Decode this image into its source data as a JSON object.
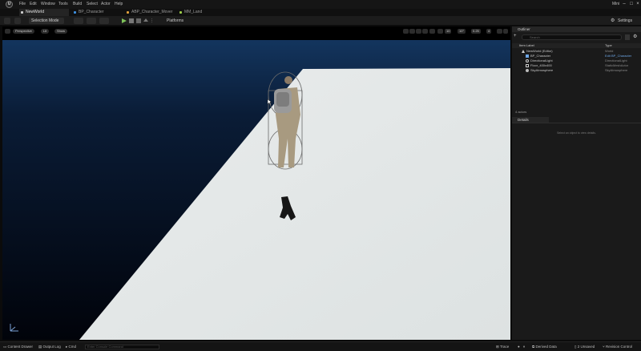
{
  "menu": {
    "items": [
      "File",
      "Edit",
      "Window",
      "Tools",
      "Build",
      "Select",
      "Actor",
      "Help"
    ],
    "window_title": "Mini"
  },
  "tabs": [
    {
      "label": "NewWorld",
      "active": true,
      "color": "#cfcfcf"
    },
    {
      "label": "BP_Character",
      "active": false,
      "color": "#3d8fe0"
    },
    {
      "label": "ABP_Character_Mover",
      "active": false,
      "color": "#e0a13d"
    },
    {
      "label": "MM_Land",
      "active": false,
      "color": "#9fd04a"
    }
  ],
  "toolbar": {
    "selection_mode": "Selection Mode",
    "platforms": "Platforms",
    "settings": "Settings"
  },
  "viewport": {
    "perspective": "Perspective",
    "lit": "Lit",
    "show": "Show",
    "grid_snap": "10",
    "rot_snap": "10°",
    "scale_snap": "0.25",
    "cam_speed": "4"
  },
  "outliner": {
    "tab_label": "Outliner",
    "search_placeholder": "Search",
    "col_label": "Item Label",
    "col_type": "Type",
    "rows": [
      {
        "label": "NewWorld (Editor)",
        "type": "World",
        "indent": 1
      },
      {
        "label": "BP_Character",
        "type": "Edit BP_Character",
        "indent": 2,
        "link": true
      },
      {
        "label": "DirectionalLight",
        "type": "DirectionalLight",
        "indent": 2
      },
      {
        "label": "Floor_400x400",
        "type": "StaticMeshActor",
        "indent": 2
      },
      {
        "label": "SkyAtmosphere",
        "type": "SkyAtmosphere",
        "indent": 2
      }
    ],
    "actor_count": "4 actors"
  },
  "details": {
    "tab_label": "Details",
    "empty_text": "Select an object to view details."
  },
  "statusbar": {
    "content_drawer": "Content Drawer",
    "output_log": "Output Log",
    "cmd": "Cmd",
    "console_placeholder": "Enter Console Command",
    "trace": "Trace",
    "derived_data": "Derived Data",
    "unsaved": "2 Unsaved",
    "revision_control": "Revision Control"
  },
  "colors": {
    "accent": "#3d8fe0",
    "floor": "#e4e8e8",
    "sky_dark": "#061428"
  }
}
